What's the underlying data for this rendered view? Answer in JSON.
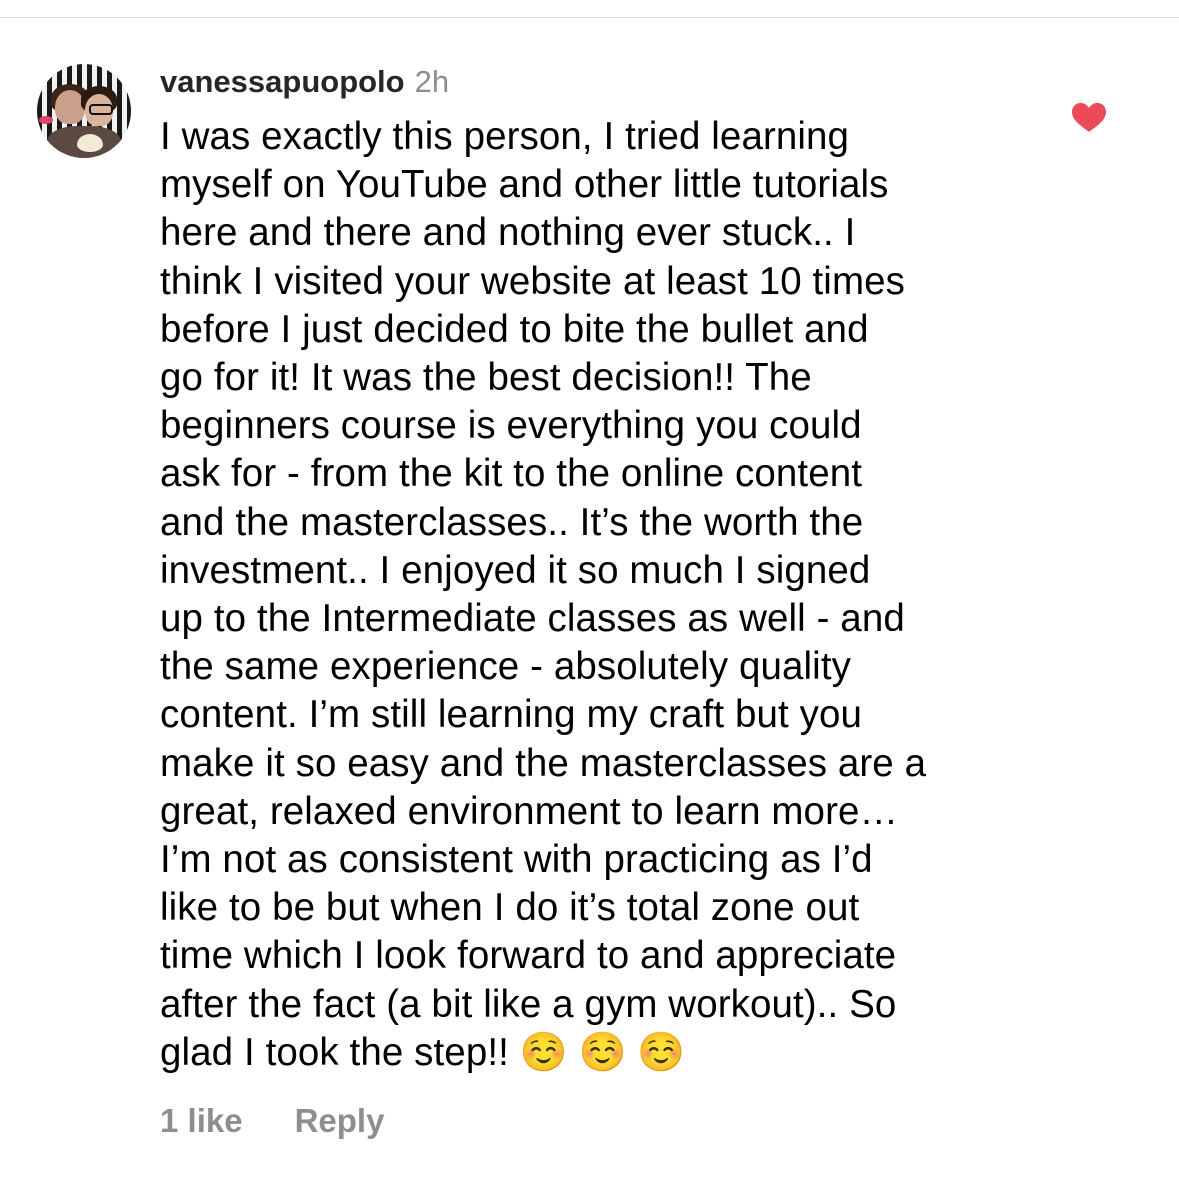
{
  "comment": {
    "username": "vanessapuopolo",
    "time": "2h",
    "text": "I was exactly this person, I tried learning\nmyself on YouTube and other little tutorials\nhere and there and nothing ever stuck.. I\nthink I visited your website at least 10 times\nbefore I just decided to bite the bullet and\ngo for it! It was the best decision!! The\nbeginners course is everything you could\nask for - from the kit to the online content\nand the masterclasses.. It’s the worth the\ninvestment.. I enjoyed it so much I signed\nup to the Intermediate classes as well - and\nthe same experience - absolutely quality\ncontent. I’m still learning my craft but you\nmake it so easy and the masterclasses are a\ngreat, relaxed environment to learn more…\nI’m not as consistent with practicing as I’d\nlike to be but when I do it’s total zone out\ntime which I look forward to and appreciate\nafter the fact (a bit like a gym workout).. So\nglad I took the step!! ☺️ ☺️ ☺️",
    "liked": true,
    "heart_icon": "heart-icon-filled",
    "heart_color": "#ed4956"
  },
  "footer": {
    "likes_label": "1 like",
    "reply_label": "Reply"
  },
  "colors": {
    "username": "#262626",
    "meta": "#8e8e8e",
    "divider": "#dbdbdb"
  }
}
